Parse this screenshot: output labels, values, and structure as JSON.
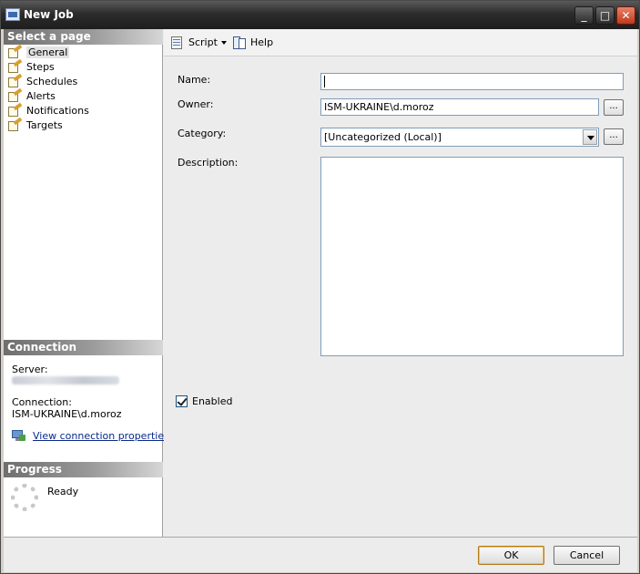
{
  "window": {
    "title": "New Job"
  },
  "titlebar_buttons": {
    "minimize": "_",
    "maximize": "□",
    "close": "✕"
  },
  "left_pane": {
    "select_page_header": "Select a page",
    "pages": [
      {
        "label": "General",
        "selected": true,
        "icon": "page-edit-icon"
      },
      {
        "label": "Steps",
        "selected": false,
        "icon": "page-edit-icon"
      },
      {
        "label": "Schedules",
        "selected": false,
        "icon": "page-edit-icon"
      },
      {
        "label": "Alerts",
        "selected": false,
        "icon": "page-edit-icon"
      },
      {
        "label": "Notifications",
        "selected": false,
        "icon": "page-edit-icon"
      },
      {
        "label": "Targets",
        "selected": false,
        "icon": "page-edit-icon"
      }
    ],
    "connection_header": "Connection",
    "server_label": "Server:",
    "connection_label": "Connection:",
    "connection_value": "ISM-UKRAINE\\d.moroz",
    "view_connection_link": "View connection properties",
    "progress_header": "Progress",
    "progress_status": "Ready"
  },
  "toolbar": {
    "script_label": "Script",
    "help_label": "Help"
  },
  "form": {
    "name_label": "Name:",
    "name_value": "",
    "owner_label": "Owner:",
    "owner_value": "ISM-UKRAINE\\d.moroz",
    "category_label": "Category:",
    "category_value": "[Uncategorized (Local)]",
    "description_label": "Description:",
    "description_value": "",
    "browse_label": "...",
    "enabled_label": "Enabled",
    "enabled_checked": true
  },
  "buttons": {
    "ok": "OK",
    "cancel": "Cancel"
  }
}
